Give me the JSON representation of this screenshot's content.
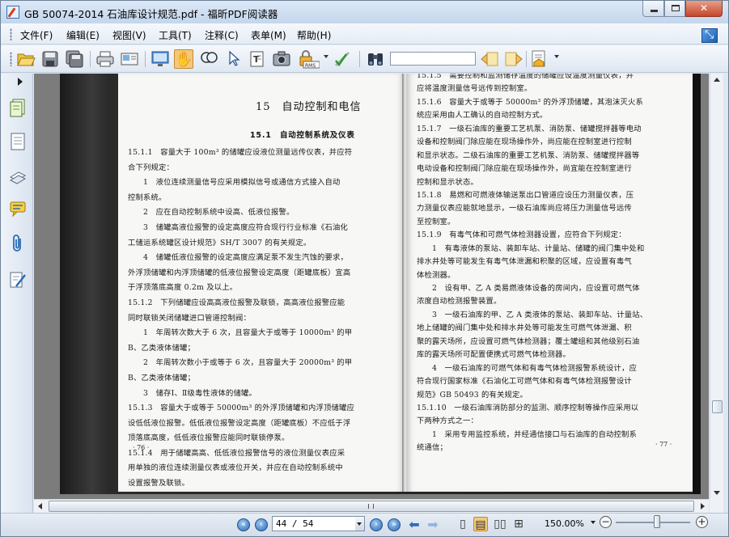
{
  "window": {
    "title": "GB 50074-2014 石油库设计规范.pdf - 福昕PDF阅读器",
    "minimize": "",
    "maximize": "",
    "close": "✕"
  },
  "menu": [
    {
      "id": "file",
      "label": "文件(F)"
    },
    {
      "id": "edit",
      "label": "编辑(E)"
    },
    {
      "id": "view",
      "label": "视图(V)"
    },
    {
      "id": "tools",
      "label": "工具(T)"
    },
    {
      "id": "comment",
      "label": "注释(C)"
    },
    {
      "id": "form",
      "label": "表单(M)"
    },
    {
      "id": "help",
      "label": "帮助(H)"
    }
  ],
  "toolbar": {
    "icons": [
      "open-icon",
      "save-icon",
      "save-as-icon",
      "print-icon",
      "email-icon",
      "fullscreen-icon",
      "hand-icon",
      "zoom-icon",
      "select-icon",
      "text-select-icon",
      "snapshot-icon",
      "rms-icon",
      "sign-icon",
      "find-icon",
      "prev-match-icon",
      "next-match-icon",
      "highlight-icon"
    ],
    "rms_label": "RMS",
    "search_value": ""
  },
  "sidebar": {
    "items": [
      "pages-icon",
      "bookmarks-icon",
      "layers-icon",
      "comments-icon",
      "attachments-icon",
      "signatures-icon"
    ]
  },
  "document": {
    "left_page": {
      "chapter_title": "15　自动控制和电信",
      "section_title": "15.1　自动控制系统及仪表",
      "lines": [
        "15.1.1　容量大于 100m³ 的储罐应设液位测量远传仪表，并应符",
        "合下列规定：",
        "　　1　液位连续测量信号应采用模拟信号或通信方式接入自动",
        "控制系统。",
        "　　2　应在自动控制系统中设高、低液位报警。",
        "　　3　储罐高液位报警的设定高度应符合现行行业标准《石油化",
        "工储运系统罐区设计规范》SH/T 3007 的有关规定。",
        "　　4　储罐低液位报警的设定高度应满足泵不发生汽蚀的要求，",
        "外浮顶储罐和内浮顶储罐的低液位报警设定高度（距罐底板）宜高",
        "于浮顶落底高度 0.2m 及以上。",
        "15.1.2　下列储罐应设高高液位报警及联锁，高高液位报警应能",
        "同时联锁关闭储罐进口管道控制阀：",
        "　　1　年周转次数大于 6 次，且容量大于或等于 10000m³ 的甲",
        "B、乙类液体储罐；",
        "　　2　年周转次数小于或等于 6 次，且容量大于 20000m³ 的甲",
        "B、乙类液体储罐；",
        "　　3　储存Ⅰ、Ⅱ级毒性液体的储罐。",
        "15.1.3　容量大于或等于 50000m³ 的外浮顶储罐和内浮顶储罐应",
        "设低低液位报警。低低液位报警设定高度（距罐底板）不应低于浮",
        "顶落底高度，低低液位报警应能同时联锁停泵。",
        "15.1.4　用于储罐高高、低低液位报警信号的液位测量仪表应采",
        "用单独的液位连续测量仪表或液位开关，并应在自动控制系统中",
        "设置报警及联锁。"
      ],
      "page_number": "· 76 ·"
    },
    "right_page": {
      "lines": [
        "15.1.5　需要控制和监测储存温度的储罐应设温度测量仪表，并",
        "应将温度测量信号远传到控制室。",
        "15.1.6　容量大于或等于 50000m³ 的外浮顶储罐，其泡沫灭火系",
        "统应采用由人工确认的自动控制方式。",
        "15.1.7　一级石油库的重要工艺机泵、消防泵、储罐搅拌器等电动",
        "设备和控制阀门除应能在现场操作外，尚应能在控制室进行控制",
        "和显示状态。二级石油库的重要工艺机泵、消防泵、储罐搅拌器等",
        "电动设备和控制阀门除应能在现场操作外，尚宜能在控制室进行",
        "控制和显示状态。",
        "15.1.8　易燃和可燃液体输送泵出口管道应设压力测量仪表，压",
        "力测量仪表应能就地显示，一级石油库尚应将压力测量信号远传",
        "至控制室。",
        "15.1.9　有毒气体和可燃气体检测器设置，应符合下列规定：",
        "　　1　有毒液体的泵站、装卸车站、计量站、储罐的阀门集中处和",
        "排水井处等可能发生有毒气体泄漏和积聚的区域，应设置有毒气",
        "体检测器。",
        "　　2　设有甲、乙 A 类易燃液体设备的房间内，应设置可燃气体",
        "浓度自动检测报警装置。",
        "　　3　一级石油库的甲、乙 A 类液体的泵站、装卸车站、计量站、",
        "地上储罐的阀门集中处和排水井处等可能发生可燃气体泄漏、积",
        "聚的露天场所，应设置可燃气体检测器；覆土罐组和其他级别石油",
        "库的露天场所可配置便携式可燃气体检测器。",
        "　　4　一级石油库的可燃气体和有毒气体检测报警系统设计，应",
        "符合现行国家标准《石油化工可燃气体和有毒气体检测报警设计",
        "规范》GB 50493 的有关规定。",
        "15.1.10　一级石油库消防部分的监测、顺序控制等操作应采用以",
        "下两种方式之一：",
        "　　1　采用专用监控系统，并经通信接口与石油库的自动控制系",
        "统通信；"
      ],
      "page_number": "· 77 ·"
    }
  },
  "statusbar": {
    "page_value": "44 / 54",
    "zoom": "150.00%",
    "zoom_level": 0.55,
    "first_page": "«",
    "prev_page": "‹",
    "next_page": "›",
    "last_page": "»",
    "zoom_out": "−",
    "zoom_in": "+"
  }
}
